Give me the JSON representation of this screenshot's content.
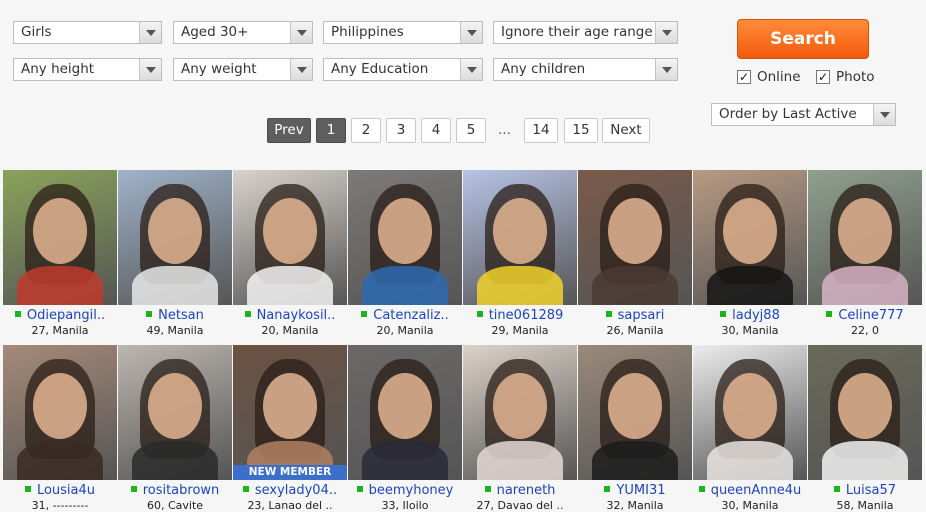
{
  "filters": [
    {
      "value": "Girls"
    },
    {
      "value": "Aged 30+"
    },
    {
      "value": "Philippines"
    },
    {
      "value": "Ignore their age range"
    },
    {
      "value": "Any height"
    },
    {
      "value": "Any weight"
    },
    {
      "value": "Any Education"
    },
    {
      "value": "Any children"
    }
  ],
  "search": {
    "label": "Search",
    "online_label": "Online",
    "photo_label": "Photo",
    "online_checked": "✓",
    "photo_checked": "✓"
  },
  "order": {
    "value": "Order by Last Active"
  },
  "pagination": {
    "prev": "Prev",
    "next": "Next",
    "current": "1",
    "pages": [
      "1",
      "2",
      "3",
      "4",
      "5",
      "14",
      "15"
    ],
    "ellipsis": "..."
  },
  "new_member_label": "NEW MEMBER",
  "colors": {
    "accent": "#f25a0c",
    "link": "#1d44b8",
    "online": "#1db31d",
    "badge": "#3c6fc9"
  },
  "profiles": [
    {
      "name": "Odiepangil..",
      "info": "27, Manila",
      "bg": "#8aa35a",
      "shirt": "#c0392b",
      "new": false
    },
    {
      "name": "Netsan",
      "info": "49, Manila",
      "bg": "#9fb3c9",
      "shirt": "#e8e8e8",
      "new": false
    },
    {
      "name": "Nanaykosil..",
      "info": "20, Manila",
      "bg": "#d8d2cc",
      "shirt": "#f2f2f2",
      "new": false
    },
    {
      "name": "Catenzaliz..",
      "info": "20, Manila",
      "bg": "#7d7a78",
      "shirt": "#2d6ab0",
      "new": false
    },
    {
      "name": "tine061289",
      "info": "29, Manila",
      "bg": "#b7c3e6",
      "shirt": "#f1d12a",
      "new": false
    },
    {
      "name": "sapsari",
      "info": "26, Manila",
      "bg": "#7a5a4a",
      "shirt": "#4a3a32",
      "new": false
    },
    {
      "name": "ladyj88",
      "info": "30, Manila",
      "bg": "#b89a83",
      "shirt": "#151515",
      "new": false
    },
    {
      "name": "Celine777",
      "info": "22, 0",
      "bg": "#8fa08e",
      "shirt": "#d7b3c4",
      "new": false
    },
    {
      "name": "Lousia4u",
      "info": "31, ---------",
      "bg": "#a68a78",
      "shirt": "#3a2a22",
      "new": false
    },
    {
      "name": "rositabrown",
      "info": "60, Cavite",
      "bg": "#bcb6b0",
      "shirt": "#2a2a2a",
      "new": false
    },
    {
      "name": "sexylady04..",
      "info": "23, Lanao del ..",
      "bg": "#6c5242",
      "shirt": "#b08060",
      "new": true
    },
    {
      "name": "beemyhoney",
      "info": "33, Iloilo",
      "bg": "#6c6868",
      "shirt": "#2a2a3a",
      "new": false
    },
    {
      "name": "nareneth",
      "info": "27, Davao del ..",
      "bg": "#dcd2c8",
      "shirt": "#e4d8d4",
      "new": false
    },
    {
      "name": "YUMI31",
      "info": "32, Manila",
      "bg": "#9a8a7a",
      "shirt": "#1c1c1c",
      "new": false
    },
    {
      "name": "queenAnne4u",
      "info": "30, Manila",
      "bg": "#ececec",
      "shirt": "#e9e4e0",
      "new": false
    },
    {
      "name": "Luisa57",
      "info": "58, Manila",
      "bg": "#6a6a5a",
      "shirt": "#f2f2f2",
      "new": false
    }
  ]
}
